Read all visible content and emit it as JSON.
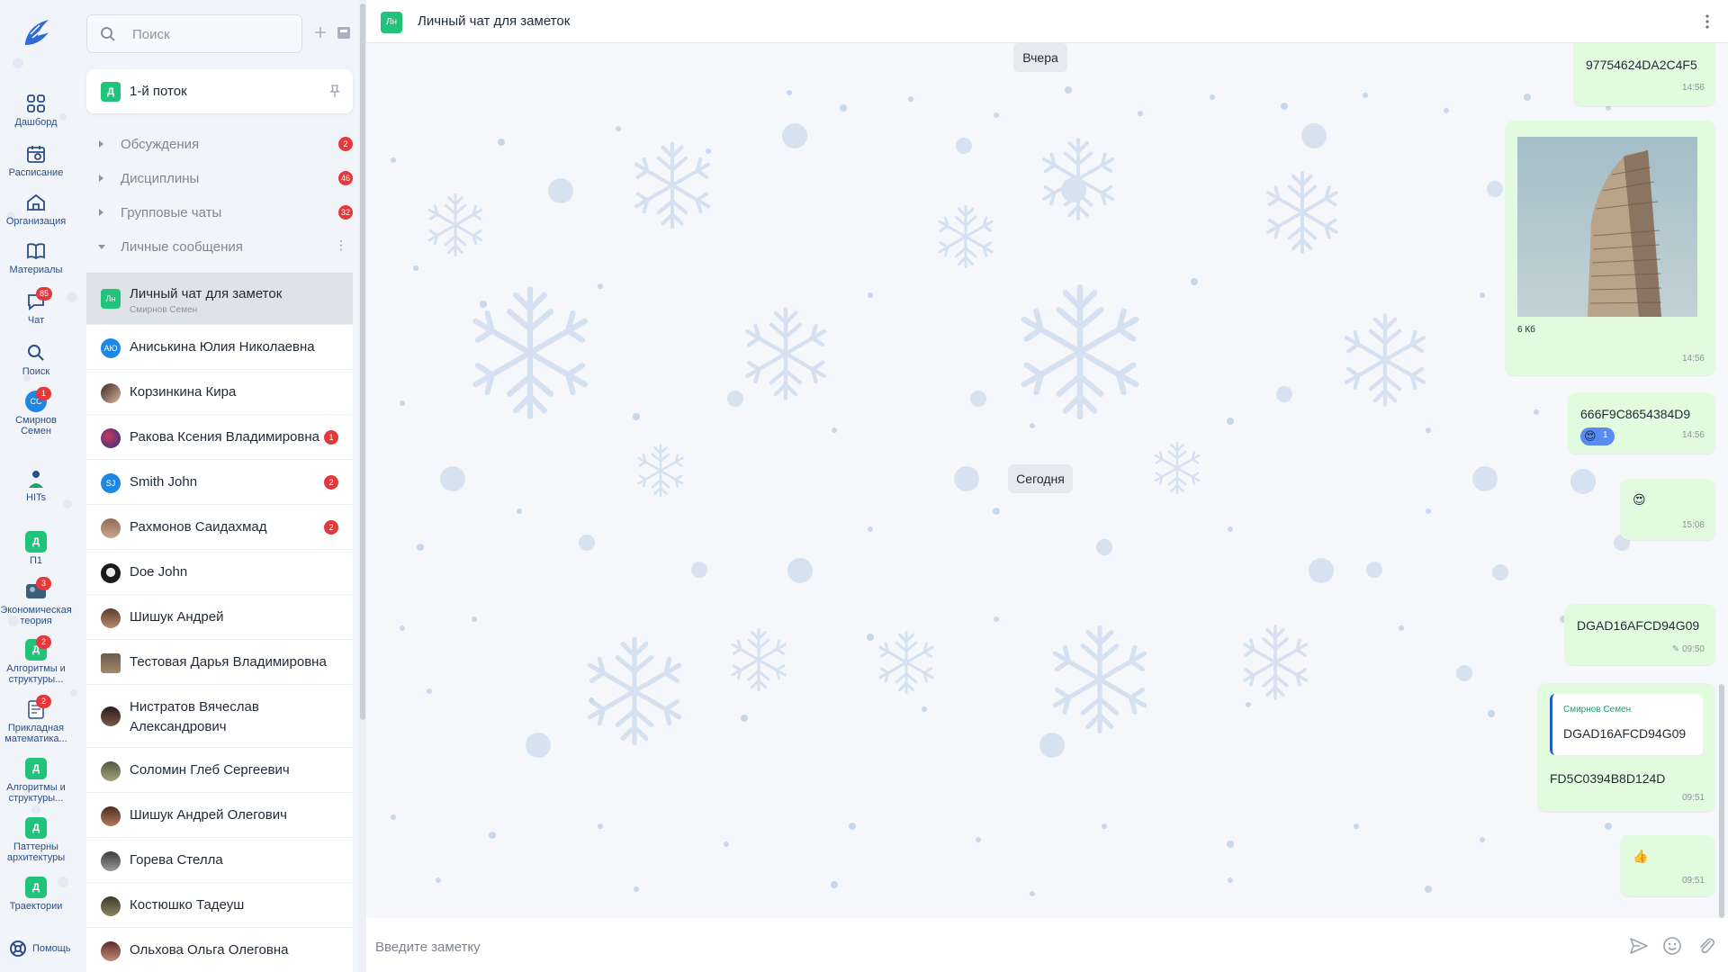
{
  "rail": {
    "items": [
      {
        "label": "Дашборд",
        "icon": "dashboard-icon"
      },
      {
        "label": "Расписание",
        "icon": "calendar-icon"
      },
      {
        "label": "Организация",
        "icon": "organization-icon"
      },
      {
        "label": "Материалы",
        "icon": "book-icon"
      },
      {
        "label": "Чат",
        "icon": "chat-icon",
        "badge": "85"
      },
      {
        "label": "Поиск",
        "icon": "search-icon"
      },
      {
        "label": "Смирнов Семен",
        "initials": "СС",
        "badge": "1"
      },
      {
        "label": "HITs",
        "icon": "hits-icon"
      },
      {
        "label": "П1",
        "letter": "Д"
      },
      {
        "label": "Экономическая теория",
        "badge": "3"
      },
      {
        "label": "Алгоритмы и структуры...",
        "letter": "Д",
        "badge": "2"
      },
      {
        "label": "Прикладная математика...",
        "badge": "2"
      },
      {
        "label": "Алгоритмы и структуры...",
        "letter": "Д"
      },
      {
        "label": "Паттерны архитектуры",
        "letter": "Д"
      },
      {
        "label": "Траектории",
        "letter": "Д"
      }
    ],
    "help_label": "Помощь"
  },
  "sidebar": {
    "search_placeholder": "Поиск",
    "stream": {
      "letter": "Д",
      "title": "1-й поток"
    },
    "sections": [
      {
        "label": "Обсуждения",
        "badge": "2"
      },
      {
        "label": "Дисциплины",
        "badge": "46"
      },
      {
        "label": "Групповые чаты",
        "badge": "32"
      },
      {
        "label": "Личные сообщения"
      }
    ],
    "dms": [
      {
        "name": "Личный чат для заметок",
        "sub": "Смирнов Семен",
        "initials": "Лн"
      },
      {
        "name": "Аниськина Юлия Николаевна",
        "initials": "АЮ"
      },
      {
        "name": "Корзинкина Кира"
      },
      {
        "name": "Ракова Ксения Владимировна",
        "badge": "1"
      },
      {
        "name": "Smith John",
        "initials": "SJ",
        "badge": "2"
      },
      {
        "name": "Рахмонов Саидахмад",
        "badge": "2"
      },
      {
        "name": "Doe John"
      },
      {
        "name": "Шишук Андрей"
      },
      {
        "name": "Тестовая Дарья Владимировна"
      },
      {
        "name": "Нистратов Вячеслав Александрович"
      },
      {
        "name": "Соломин Глеб Сергеевич"
      },
      {
        "name": "Шишук Андрей Олегович"
      },
      {
        "name": "Горева Стелла"
      },
      {
        "name": "Костюшко Тадеуш"
      },
      {
        "name": "Ольхова Ольга Олеговна"
      }
    ]
  },
  "chat": {
    "header": {
      "initials": "Лн",
      "title": "Личный чат для заметок"
    },
    "date_yesterday": "Вчера",
    "date_today": "Сегодня",
    "messages": [
      {
        "text": "97754624DA2C4F5",
        "time": "14:56"
      },
      {
        "image_caption": "6 Кб",
        "time": "14:56"
      },
      {
        "text": "666F9C8654384D9",
        "time": "14:56",
        "reaction": "😍",
        "reaction_count": "1"
      },
      {
        "text": "😍",
        "time": "15:08"
      },
      {
        "text": "DGAD16AFCD94G09",
        "time": "09:50",
        "edited": "✎"
      },
      {
        "quote_author": "Смирнов Семен",
        "quote_text": "DGAD16AFCD94G09",
        "text": "FD5C0394B8D124D",
        "time": "09:51"
      },
      {
        "text": "👍",
        "time": "09:51"
      }
    ],
    "composer_placeholder": "Введите заметку"
  }
}
